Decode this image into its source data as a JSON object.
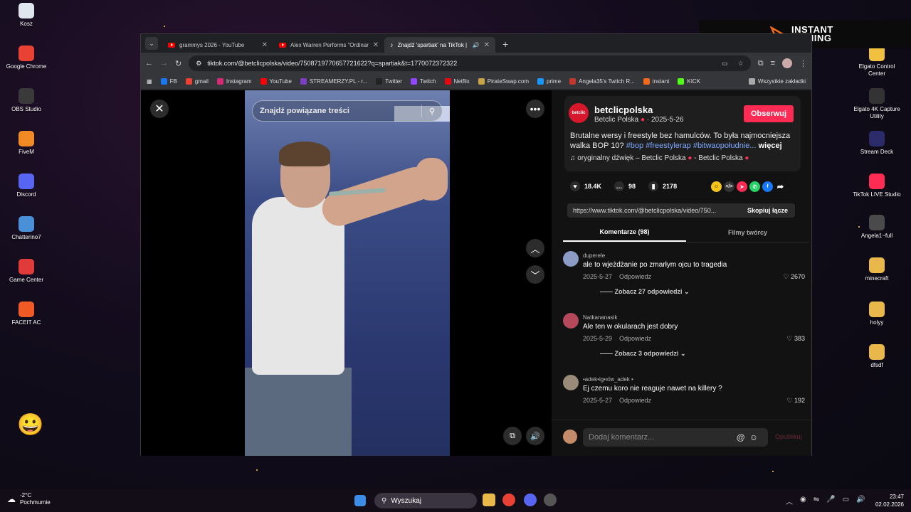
{
  "desktop": {
    "left_icons": [
      {
        "label": "Kosz",
        "color": "#dfe6ee"
      },
      {
        "label": "Google Chrome",
        "color": "#e94235"
      },
      {
        "label": "OBS Studio",
        "color": "#3a3a3a"
      },
      {
        "label": "FiveM",
        "color": "#f08a24"
      },
      {
        "label": "Discord",
        "color": "#5865f2"
      },
      {
        "label": "Chatterino7",
        "color": "#4a90d9"
      },
      {
        "label": "Game Center",
        "color": "#e03a3a"
      },
      {
        "label": "FACEIT AC",
        "color": "#f15a24"
      }
    ],
    "right_icons": [
      {
        "label": "Elgato Control Center",
        "color": "#f0c040"
      },
      {
        "label": "Elgato 4K Capture Utility",
        "color": "#333"
      },
      {
        "label": "Stream Deck",
        "color": "#2b2b6a"
      },
      {
        "label": "TikTok LIVE Studio",
        "color": "#fe2c55"
      },
      {
        "label": "Angela1~full",
        "color": "#4a4a4a"
      },
      {
        "label": "minecraft",
        "color": "#e8b84a"
      },
      {
        "label": "holyy",
        "color": "#e8b84a"
      },
      {
        "label": "dfsdf",
        "color": "#e8b84a"
      }
    ],
    "banner": {
      "line1": "INSTANT",
      "line2": "GAMING"
    }
  },
  "browser": {
    "tabs": [
      {
        "title": "grammys 2026 - YouTube",
        "icon": "youtube-icon"
      },
      {
        "title": "Alex Warren Performs “Ordinary”",
        "icon": "youtube-icon"
      },
      {
        "title": "Znajdź 'spartiak' na TikTok |",
        "icon": "tiktok-icon"
      }
    ],
    "url": "tiktok.com/@betclicpolska/video/7508719770657721622?q=spartiak&t=1770072372322",
    "bookmarks": [
      {
        "label": "FB",
        "color": "#1877f2"
      },
      {
        "label": "gmail",
        "color": "#ea4335"
      },
      {
        "label": "Instagram",
        "color": "#d62976"
      },
      {
        "label": "YouTube",
        "color": "#ff0000"
      },
      {
        "label": "STREAMERZY.PL - r...",
        "color": "#7b3fbf"
      },
      {
        "label": "Twitter",
        "color": "#222"
      },
      {
        "label": "Twitch",
        "color": "#9146ff"
      },
      {
        "label": "Netflix",
        "color": "#e50914"
      },
      {
        "label": "PirateSwap.com",
        "color": "#c9a24a"
      },
      {
        "label": "prime",
        "color": "#1a98ff"
      },
      {
        "label": "Angela35's Twitch R...",
        "color": "#c0392b"
      },
      {
        "label": "instant",
        "color": "#f26b1d"
      },
      {
        "label": "KICK",
        "color": "#53fc18"
      }
    ],
    "all_bookmarks": "Wszystkie zakładki"
  },
  "tiktok": {
    "search_placeholder": "Znajdź powiązane treści",
    "username": "betclicpolska",
    "display_name": "Betclic Polska",
    "date": "· 2025-5-26",
    "avatar_text": "betclic",
    "follow_label": "Obserwuj",
    "description": "Brutalne wersy i freestyle bez hamulców. To była najmocniejsza walka BOP 10?",
    "hashtags": "#bop #freestylerap #bitwaopołudnie...",
    "more_label": "więcej",
    "sound": "oryginalny dźwięk – Betclic Polska",
    "sound_suffix": "- Betclic Polska",
    "likes": "18.4K",
    "comments_count": "98",
    "saves": "2178",
    "share_link": "https://www.tiktok.com/@betclicpolska/video/750...",
    "copy_label": "Skopiuj łącze",
    "tab_comments": "Komentarze (98)",
    "tab_videos": "Filmy twórcy",
    "comments": [
      {
        "user": "duperele",
        "text": "ale to wjeżdżanie po zmarłym ojcu to tragedia",
        "date": "2025-5-27",
        "reply": "Odpowiedz",
        "likes": "2670",
        "replies": "Zobacz 27 odpowiedzi",
        "avatar": "#8c9cc4"
      },
      {
        "user": "Natkananasik",
        "text": "Ale ten w okularach jest dobry",
        "date": "2025-5-29",
        "reply": "Odpowiedz",
        "likes": "383",
        "replies": "Zobacz 3 odpowiedzi",
        "avatar": "#b5485a"
      },
      {
        "user": "•adek•ig•xtw_adek •",
        "text": "Ej czemu koro nie reaguje nawet na killery ?",
        "date": "2025-5-27",
        "reply": "Odpowiedz",
        "likes": "192",
        "replies": "",
        "avatar": "#9a8a7a"
      }
    ],
    "composer_placeholder": "Dodaj komentarz...",
    "post_label": "Opublikuj"
  },
  "taskbar": {
    "temp": "-2°C",
    "weather": "Pochmurnie",
    "search": "Wyszukaj",
    "time": "23:47",
    "date": "02.02.2026"
  }
}
